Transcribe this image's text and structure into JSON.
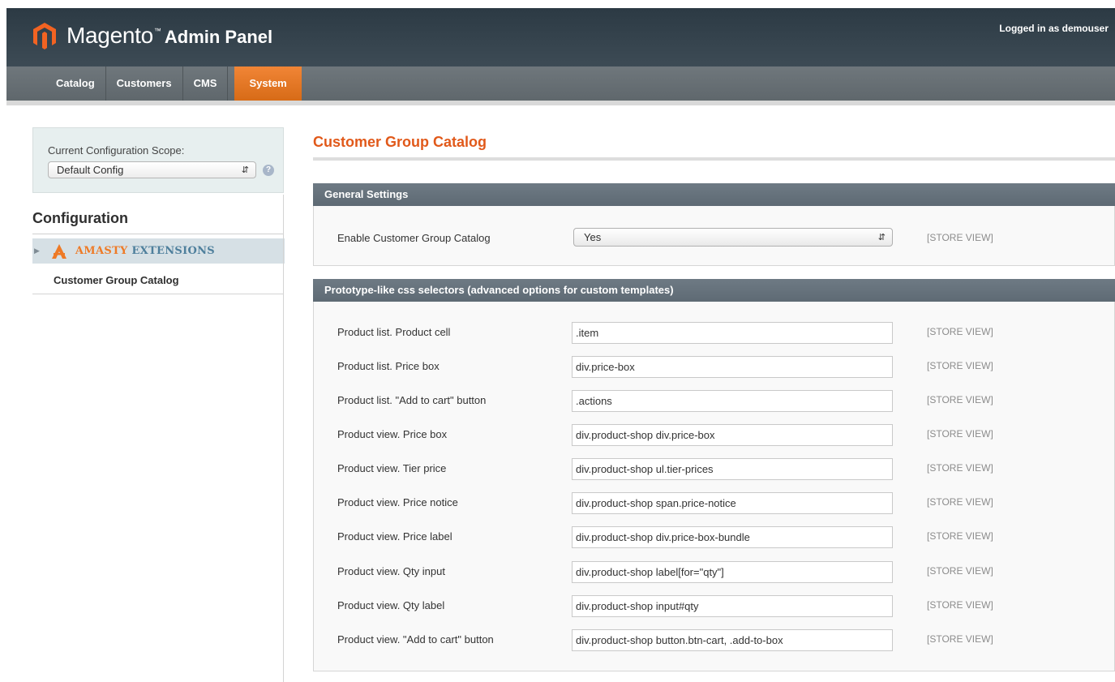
{
  "header": {
    "logo_word": "Magento",
    "logo_tm": "™",
    "logo_sub": "Admin Panel",
    "user_info": "Logged in as demouser"
  },
  "nav": {
    "items": [
      {
        "label": "Catalog"
      },
      {
        "label": "Customers"
      },
      {
        "label": "CMS"
      },
      {
        "label": "System",
        "active": true
      }
    ]
  },
  "sidebar": {
    "scope_label": "Current Configuration Scope:",
    "scope_value": "Default Config",
    "title": "Configuration",
    "group": {
      "label_a": "AMASTY",
      "label_b": "EXTENSIONS"
    },
    "active_item": "Customer Group Catalog"
  },
  "main": {
    "page_title": "Customer Group Catalog",
    "general": {
      "heading": "General Settings",
      "enable_label": "Enable Customer Group Catalog",
      "enable_value": "Yes",
      "enable_scope": "[STORE VIEW]"
    },
    "selectors": {
      "heading": "Prototype-like css selectors (advanced options for custom templates)",
      "rows": [
        {
          "label": "Product list. Product cell",
          "value": ".item",
          "scope": "[STORE VIEW]"
        },
        {
          "label": "Product list. Price box",
          "value": "div.price-box",
          "scope": "[STORE VIEW]"
        },
        {
          "label": "Product list. \"Add to cart\" button",
          "value": ".actions",
          "scope": "[STORE VIEW]"
        },
        {
          "label": "Product view. Price box",
          "value": "div.product-shop div.price-box",
          "scope": "[STORE VIEW]"
        },
        {
          "label": "Product view. Tier price",
          "value": "div.product-shop ul.tier-prices",
          "scope": "[STORE VIEW]"
        },
        {
          "label": "Product view. Price notice",
          "value": "div.product-shop span.price-notice",
          "scope": "[STORE VIEW]"
        },
        {
          "label": "Product view. Price label",
          "value": "div.product-shop div.price-box-bundle",
          "scope": "[STORE VIEW]"
        },
        {
          "label": "Product view. Qty input",
          "value": "div.product-shop label[for=\"qty\"]",
          "scope": "[STORE VIEW]"
        },
        {
          "label": "Product view. Qty label",
          "value": "div.product-shop input#qty",
          "scope": "[STORE VIEW]"
        },
        {
          "label": "Product view. \"Add to cart\" button",
          "value": "div.product-shop button.btn-cart, .add-to-box",
          "scope": "[STORE VIEW]"
        }
      ]
    }
  },
  "colors": {
    "accent": "#e1591a",
    "nav_active": "#eb7a2a",
    "header_bg": "#2c3a44",
    "section_head": "#66727c"
  },
  "icons": {
    "logo": "magento-logo-icon",
    "help": "help-icon",
    "expand": "expand-arrow-icon",
    "amasty": "amasty-logo-icon",
    "select": "select-updown-icon"
  }
}
